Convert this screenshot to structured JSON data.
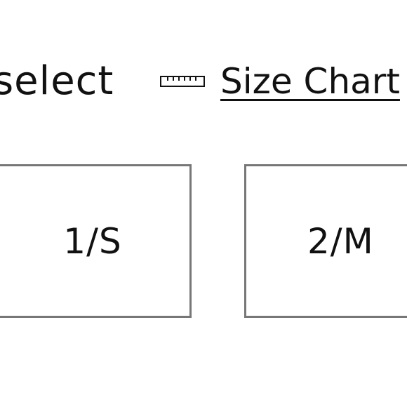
{
  "header": {
    "select_label": "select",
    "size_chart_label": "Size Chart",
    "size_chart_icon": "ruler-icon"
  },
  "size_options": [
    {
      "label": "1/S"
    },
    {
      "label": "2/M"
    }
  ],
  "colors": {
    "text": "#111111",
    "option_border": "#777777",
    "background": "#ffffff"
  }
}
